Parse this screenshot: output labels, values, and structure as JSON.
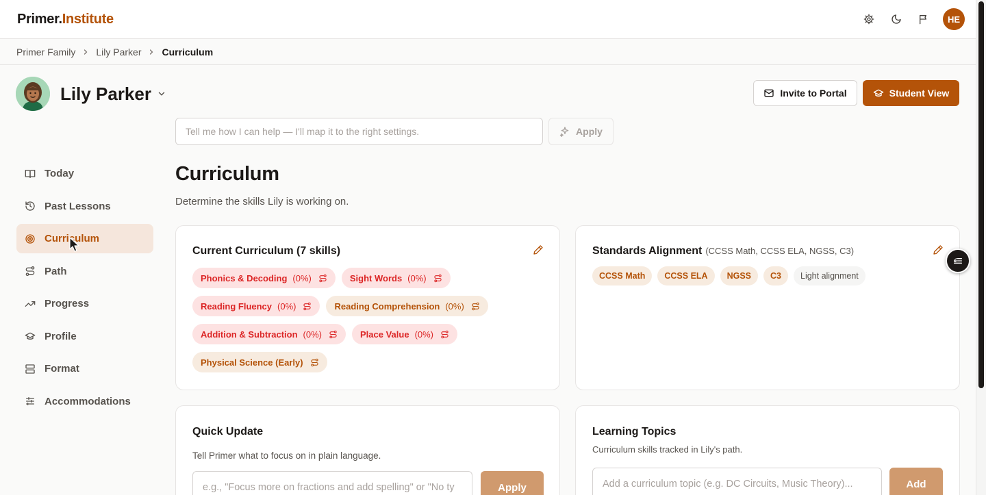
{
  "header": {
    "logo_part1": "Primer.",
    "logo_part2": "Institute",
    "icons": [
      "settings-icon",
      "moon-icon",
      "flag-icon"
    ],
    "user_initials": "HE",
    "accent_color": "#b45309"
  },
  "breadcrumb": {
    "items": [
      "Primer Family",
      "Lily Parker",
      "Curriculum"
    ]
  },
  "student": {
    "name": "Lily Parker"
  },
  "actions": {
    "invite_label": "Invite to Portal",
    "student_view_label": "Student View"
  },
  "assistant": {
    "placeholder": "Tell me how I can help — I'll map it to the right settings.",
    "apply_label": "Apply"
  },
  "sidebar": {
    "items": [
      {
        "label": "Today",
        "icon": "book-open-icon"
      },
      {
        "label": "Past Lessons",
        "icon": "history-icon"
      },
      {
        "label": "Curriculum",
        "icon": "target-icon",
        "active": true
      },
      {
        "label": "Path",
        "icon": "route-icon"
      },
      {
        "label": "Progress",
        "icon": "trending-up-icon"
      },
      {
        "label": "Profile",
        "icon": "graduation-cap-icon"
      },
      {
        "label": "Format",
        "icon": "layout-icon"
      },
      {
        "label": "Accommodations",
        "icon": "sliders-icon"
      }
    ]
  },
  "page": {
    "title": "Curriculum",
    "subtitle": "Determine the skills Lily is working on."
  },
  "current_curriculum": {
    "title": "Current Curriculum (7 skills)",
    "skills": [
      {
        "name": "Phonics & Decoding",
        "pct": "(0%)",
        "tone": "red"
      },
      {
        "name": "Sight Words",
        "pct": "(0%)",
        "tone": "red"
      },
      {
        "name": "Reading Fluency",
        "pct": "(0%)",
        "tone": "red"
      },
      {
        "name": "Reading Comprehension",
        "pct": "(0%)",
        "tone": "amber"
      },
      {
        "name": "Addition & Subtraction",
        "pct": "(0%)",
        "tone": "red"
      },
      {
        "name": "Place Value",
        "pct": "(0%)",
        "tone": "red"
      },
      {
        "name": "Physical Science (Early)",
        "pct": "",
        "tone": "amber"
      }
    ]
  },
  "standards": {
    "title": "Standards Alignment",
    "subtitle": "(CCSS Math, CCSS ELA, NGSS, C3)",
    "chips": [
      "CCSS Math",
      "CCSS ELA",
      "NGSS",
      "C3"
    ],
    "level": "Light alignment"
  },
  "quick_update": {
    "title": "Quick Update",
    "description": "Tell Primer what to focus on in plain language.",
    "placeholder": "e.g., \"Focus more on fractions and add spelling\" or \"No ty",
    "apply_label": "Apply"
  },
  "learning_topics": {
    "title": "Learning Topics",
    "description": "Curriculum skills tracked in Lily's path.",
    "placeholder": "Add a curriculum topic (e.g. DC Circuits, Music Theory)...",
    "add_label": "Add"
  }
}
